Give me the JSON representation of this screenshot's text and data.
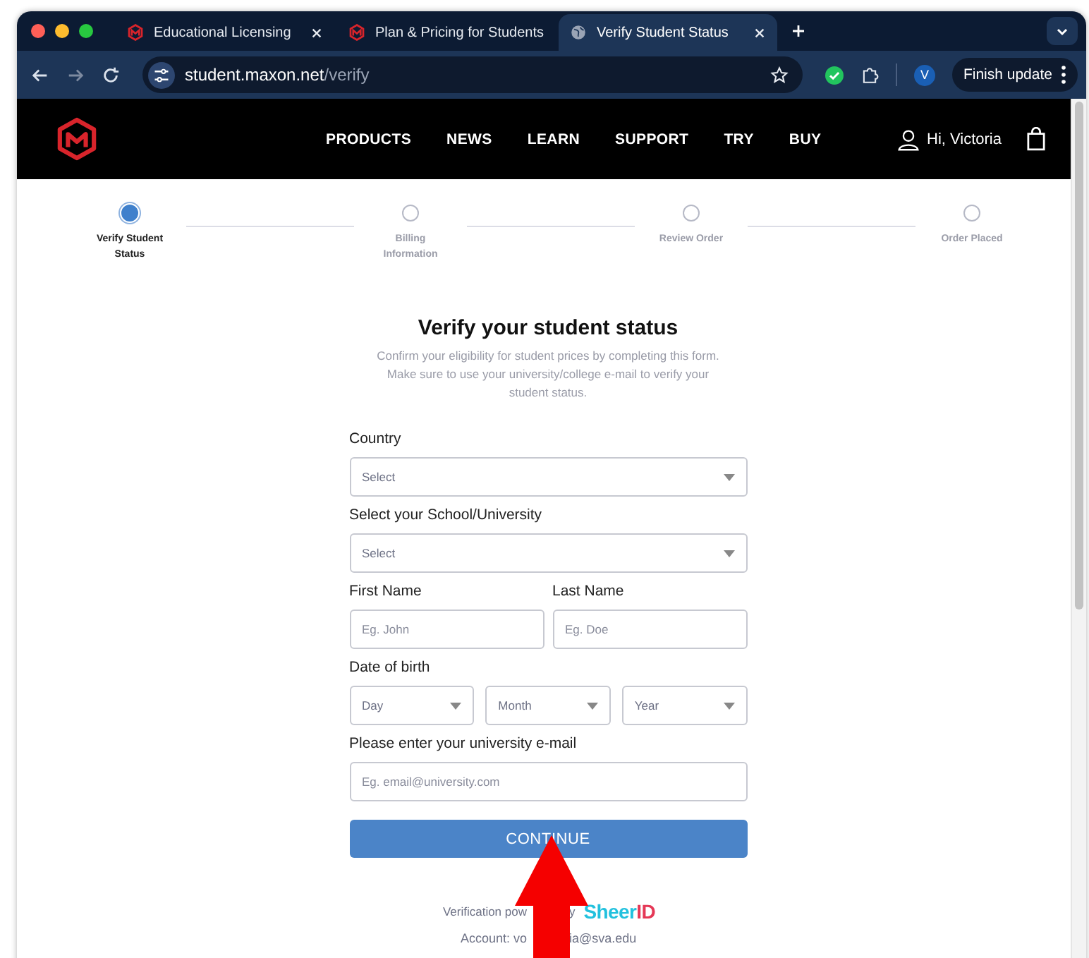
{
  "browser": {
    "tabs": [
      {
        "title": "Educational Licensing",
        "kind": "maxon",
        "selected": false
      },
      {
        "title": "Plan & Pricing for Students",
        "kind": "maxon",
        "selected": false
      },
      {
        "title": "Verify Student Status",
        "kind": "globe",
        "selected": true
      }
    ],
    "address": {
      "host": "student.maxon.net",
      "path": "/verify"
    },
    "profile_initial": "V",
    "update_button": "Finish update"
  },
  "site_nav": {
    "items": [
      "PRODUCTS",
      "NEWS",
      "LEARN",
      "SUPPORT",
      "TRY",
      "BUY"
    ],
    "greeting": "Hi, Victoria"
  },
  "steps": [
    {
      "label": "Verify Student Status",
      "selected": true
    },
    {
      "label": "Billing Information",
      "selected": false
    },
    {
      "label": "Review Order",
      "selected": false
    },
    {
      "label": "Order Placed",
      "selected": false
    }
  ],
  "form": {
    "title": "Verify your student status",
    "intro": "Confirm your eligibility for student prices by completing this form. Make sure to use your university/college e-mail to verify your student status.",
    "rows": [
      {
        "fields": [
          {
            "label": "Country",
            "controls": [
              {
                "kind": "select",
                "placeholder": "Select"
              }
            ]
          }
        ]
      },
      {
        "fields": [
          {
            "label": "Select your School/University",
            "controls": [
              {
                "kind": "select",
                "placeholder": "Select"
              }
            ]
          }
        ]
      },
      {
        "fields": [
          {
            "label": "First Name",
            "controls": [
              {
                "kind": "text",
                "placeholder": "Eg. John"
              }
            ]
          },
          {
            "label": "Last Name",
            "controls": [
              {
                "kind": "text",
                "placeholder": "Eg. Doe"
              }
            ]
          }
        ]
      },
      {
        "fields": [
          {
            "label": "Date of birth",
            "controls": [
              {
                "kind": "select",
                "placeholder": "Day"
              },
              {
                "kind": "select",
                "placeholder": "Month"
              },
              {
                "kind": "select",
                "placeholder": "Year"
              }
            ]
          }
        ]
      },
      {
        "fields": [
          {
            "label": "Please enter your university e-mail",
            "controls": [
              {
                "kind": "text",
                "placeholder": "Eg. email@university.com"
              }
            ]
          }
        ]
      }
    ],
    "button": "CONTINUE",
    "powered_by": [
      "Verification pow",
      "y"
    ],
    "brand": {
      "first": "Sheer",
      "second": "ID"
    },
    "account": [
      "Account: vo",
      "ia@sva.edu"
    ]
  }
}
